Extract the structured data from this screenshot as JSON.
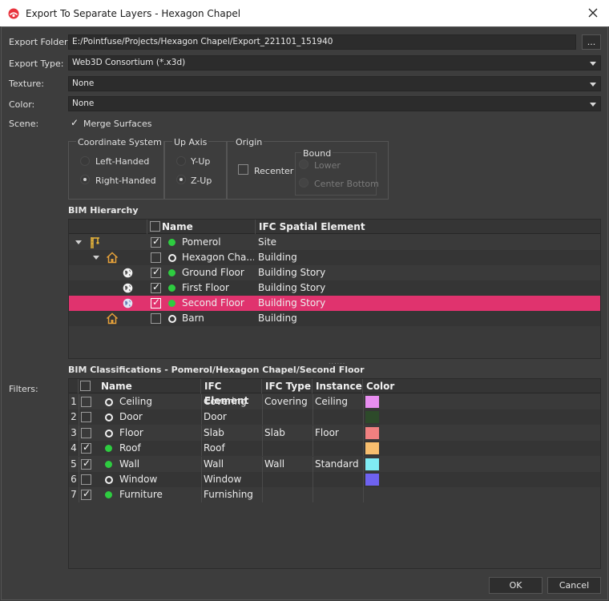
{
  "window": {
    "title": "Export To Separate Layers - Hexagon Chapel"
  },
  "export_folder": {
    "label": "Export Folder:",
    "value": "E:/Pointfuse/Projects/Hexagon Chapel/Export_221101_151940",
    "browse_label": "..."
  },
  "export_type": {
    "label": "Export Type:",
    "value": "Web3D Consortium (*.x3d)"
  },
  "texture": {
    "label": "Texture:",
    "value": "None"
  },
  "color": {
    "label": "Color:",
    "value": "None"
  },
  "scene": {
    "label": "Scene:",
    "merge_surfaces": "Merge Surfaces",
    "merge_surfaces_checked": true
  },
  "coordinate_system": {
    "title": "Coordinate System",
    "options": [
      "Left-Handed",
      "Right-Handed"
    ],
    "selected": "Right-Handed"
  },
  "up_axis": {
    "title": "Up Axis",
    "options": [
      "Y-Up",
      "Z-Up"
    ],
    "selected": "Z-Up"
  },
  "origin": {
    "title": "Origin",
    "recenter": "Recenter",
    "recenter_checked": false,
    "bound_title": "Bound",
    "bound_options": [
      "Lower",
      "Center Bottom"
    ]
  },
  "hierarchy": {
    "title": "BIM Hierarchy",
    "columns": [
      "Name",
      "IFC Spatial Element"
    ],
    "rows": [
      {
        "name": "Pomerol",
        "element": "Site",
        "checked": true,
        "status": "green",
        "icon": "crane-icon",
        "level": 0,
        "expanded": true
      },
      {
        "name": "Hexagon Cha...",
        "element": "Building",
        "checked": false,
        "status": "ring",
        "icon": "house-icon",
        "level": 1,
        "expanded": true
      },
      {
        "name": "Ground Floor",
        "element": "Building Story",
        "checked": true,
        "status": "green",
        "icon": "globe-icon",
        "level": 2
      },
      {
        "name": "First Floor",
        "element": "Building Story",
        "checked": true,
        "status": "green",
        "icon": "globe-icon",
        "level": 2
      },
      {
        "name": "Second Floor",
        "element": "Building Story",
        "checked": true,
        "status": "green",
        "icon": "globe-icon",
        "level": 2,
        "selected": true
      },
      {
        "name": "Barn",
        "element": "Building",
        "checked": false,
        "status": "ring",
        "icon": "house-icon",
        "level": 1
      }
    ]
  },
  "filters": {
    "label": "Filters:"
  },
  "classifications": {
    "title": "BIM Classifications - Pomerol/Hexagon Chapel/Second Floor",
    "columns": [
      "Name",
      "IFC Element",
      "IFC Type",
      "Instance",
      "Color"
    ],
    "rows": [
      {
        "num": "1",
        "name": "Ceiling",
        "element": "Covering",
        "type": "Covering",
        "instance": "Ceiling",
        "checked": false,
        "status": "ring",
        "color": "#e88ef0"
      },
      {
        "num": "2",
        "name": "Door",
        "element": "Door",
        "type": "",
        "instance": "",
        "checked": false,
        "status": "ring",
        "color": "#2d4a2a"
      },
      {
        "num": "3",
        "name": "Floor",
        "element": "Slab",
        "type": "Slab",
        "instance": "Floor",
        "checked": false,
        "status": "ring",
        "color": "#f08080"
      },
      {
        "num": "4",
        "name": "Roof",
        "element": "Roof",
        "type": "",
        "instance": "",
        "checked": true,
        "status": "green",
        "color": "#f7be6e"
      },
      {
        "num": "5",
        "name": "Wall",
        "element": "Wall",
        "type": "Wall",
        "instance": "Standard",
        "checked": true,
        "status": "green",
        "color": "#80ecf4"
      },
      {
        "num": "6",
        "name": "Window",
        "element": "Window",
        "type": "",
        "instance": "",
        "checked": false,
        "status": "ring",
        "color": "#6e62f0"
      },
      {
        "num": "7",
        "name": "Furniture",
        "element": "Furnishing",
        "type": "",
        "instance": "",
        "checked": true,
        "status": "green",
        "color": ""
      }
    ]
  },
  "buttons": {
    "ok": "OK",
    "cancel": "Cancel"
  }
}
